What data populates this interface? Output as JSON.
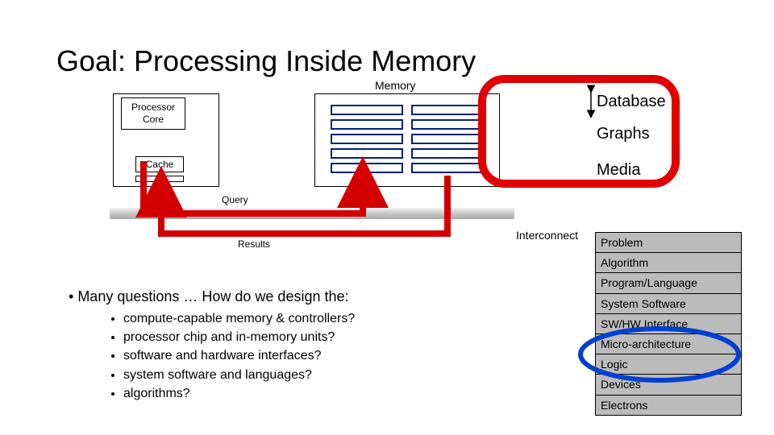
{
  "title": "Goal: Processing Inside Memory",
  "diagram": {
    "processor_core": "Processor\nCore",
    "cache": "Cache",
    "memory_label": "Memory",
    "query_label": "Query",
    "results_label": "Results",
    "interconnect_label": "Interconnect"
  },
  "applications": {
    "a1": "Database",
    "a2": "Graphs",
    "a3": "Media"
  },
  "stack": {
    "s0": "Problem",
    "s1": "Algorithm",
    "s2": "Program/Language",
    "s3": "System Software",
    "s4": "SW/HW Interface",
    "s5": "Micro-architecture",
    "s6": "Logic",
    "s7": "Devices",
    "s8": "Electrons"
  },
  "question_lead": "Many questions … How do we design the:",
  "sub_questions": {
    "q0": "compute-capable memory & controllers?",
    "q1": "processor chip and in-memory units?",
    "q2": "software and hardware interfaces?",
    "q3": "system software and languages?",
    "q4": "algorithms?"
  }
}
